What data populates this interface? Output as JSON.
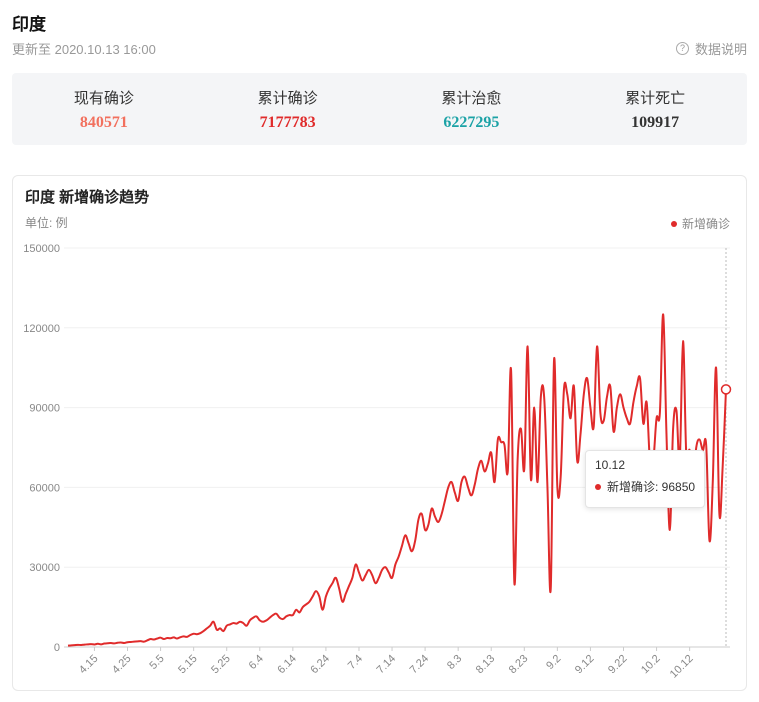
{
  "header": {
    "title": "印度",
    "updated": "更新至 2020.10.13 16:00",
    "help_label": "数据说明",
    "help_icon": "question-circle-icon"
  },
  "stats": [
    {
      "label": "现有确诊",
      "value": "840571",
      "color": "#f2705e"
    },
    {
      "label": "累计确诊",
      "value": "7177783",
      "color": "#e02b2b"
    },
    {
      "label": "累计治愈",
      "value": "6227295",
      "color": "#1ba2a6"
    },
    {
      "label": "累计死亡",
      "value": "109917",
      "color": "#333333"
    }
  ],
  "chart_section": {
    "title": "印度 新增确诊趋势",
    "unit": "单位: 例",
    "legend_label": "新增确诊"
  },
  "tooltip": {
    "date": "10.12",
    "label": "新增确诊: 96850"
  },
  "chart_data": {
    "type": "line",
    "title": "印度 新增确诊趋势",
    "color": "#e02b2b",
    "ylim": [
      0,
      150000
    ],
    "yticks": [
      0,
      30000,
      60000,
      90000,
      120000,
      150000
    ],
    "xtick_labels": [
      "4.15",
      "4.25",
      "5.5",
      "5.15",
      "5.25",
      "6.4",
      "6.14",
      "6.24",
      "7.4",
      "7.14",
      "7.24",
      "8.3",
      "8.13",
      "8.23",
      "9.2",
      "9.12",
      "9.22",
      "10.2",
      "10.12"
    ],
    "grid": true,
    "legend": "top-right",
    "x_start": "4.7",
    "x_end": "10.12",
    "series": [
      {
        "name": "新增确诊",
        "values": [
          500,
          600,
          700,
          800,
          750,
          900,
          1000,
          1100,
          950,
          1200,
          1000,
          1300,
          1400,
          1500,
          1350,
          1600,
          1700,
          1500,
          1800,
          1900,
          2000,
          2100,
          2200,
          2000,
          2500,
          3000,
          2800,
          3200,
          3500,
          3000,
          3400,
          3300,
          3600,
          3200,
          3700,
          4000,
          3800,
          4500,
          5000,
          4800,
          5200,
          6000,
          7000,
          8000,
          9500,
          6500,
          7000,
          6000,
          8000,
          8500,
          9000,
          8800,
          9500,
          9000,
          8000,
          10000,
          11000,
          11500,
          10000,
          9500,
          10000,
          11000,
          12000,
          12500,
          11000,
          10500,
          11500,
          12000,
          12000,
          14000,
          13000,
          15000,
          16000,
          17000,
          19000,
          21000,
          19000,
          14000,
          19000,
          22000,
          24000,
          26000,
          22000,
          17000,
          20000,
          23000,
          26000,
          31000,
          28000,
          25000,
          27000,
          29000,
          27000,
          24000,
          26000,
          29000,
          30000,
          28000,
          26000,
          31000,
          34000,
          38000,
          42000,
          39000,
          36000,
          40000,
          48000,
          50000,
          44000,
          46000,
          52000,
          49000,
          47000,
          50000,
          55000,
          60000,
          62000,
          58000,
          55000,
          62000,
          64000,
          60000,
          57000,
          61000,
          67000,
          70000,
          66000,
          69000,
          73000,
          62000,
          78000,
          77000,
          76000,
          66000,
          104000,
          24000,
          71000,
          82000,
          67000,
          113000,
          63000,
          90000,
          62000,
          94000,
          94000,
          60000,
          22000,
          108000,
          60000,
          64000,
          97000,
          95000,
          86000,
          98000,
          70000,
          80000,
          95000,
          101000,
          90000,
          83000,
          113000,
          88000,
          85000,
          94000,
          98000,
          81000,
          90000,
          95000,
          90000,
          86000,
          84000,
          92000,
          98000,
          101000,
          84000,
          92000,
          70000,
          70000,
          86000,
          88000,
          125000,
          80000,
          44000,
          82000,
          89000,
          70000,
          115000,
          72000,
          74000,
          62000,
          75000,
          78000,
          74000,
          76000,
          40000,
          62000,
          105000,
          50000,
          68000,
          96850
        ]
      }
    ]
  }
}
